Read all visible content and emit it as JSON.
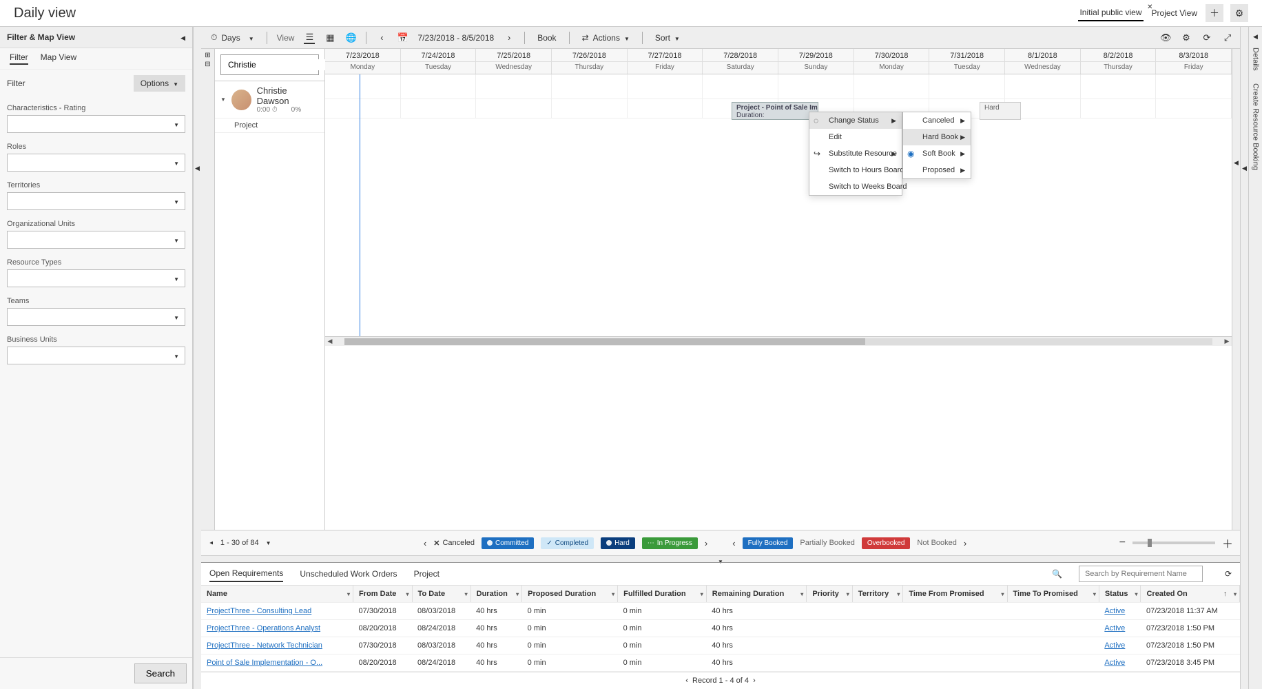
{
  "title": "Daily view",
  "views": {
    "active": "Initial public view",
    "other": "Project View"
  },
  "toolbar": {
    "days": "Days",
    "view": "View",
    "date_range": "7/23/2018 - 8/5/2018",
    "book": "Book",
    "actions": "Actions",
    "sort": "Sort"
  },
  "sidebar": {
    "title": "Filter & Map View",
    "tabs": {
      "filter": "Filter",
      "map": "Map View"
    },
    "filter_label": "Filter",
    "options": "Options",
    "fields": [
      "Characteristics - Rating",
      "Roles",
      "Territories",
      "Organizational Units",
      "Resource Types",
      "Teams",
      "Business Units"
    ],
    "search": "Search"
  },
  "resource": {
    "search_value": "Christie",
    "name": "Christie Dawson",
    "hours": "0:00",
    "pct": "0%",
    "sub": "Project"
  },
  "calendar": {
    "dates": [
      "7/23/2018",
      "7/24/2018",
      "7/25/2018",
      "7/26/2018",
      "7/27/2018",
      "7/28/2018",
      "7/29/2018",
      "7/30/2018",
      "7/31/2018",
      "8/1/2018",
      "8/2/2018",
      "8/3/2018"
    ],
    "dows": [
      "Monday",
      "Tuesday",
      "Wednesday",
      "Thursday",
      "Friday",
      "Saturday",
      "Sunday",
      "Monday",
      "Tuesday",
      "Wednesday",
      "Thursday",
      "Friday"
    ],
    "booking_title": "Project - Point of Sale Implemen",
    "booking_sub": "Duration:",
    "booking2": "Hard"
  },
  "context_menu": {
    "change_status": "Change Status",
    "edit": "Edit",
    "substitute": "Substitute Resource",
    "hours": "Switch to Hours Board",
    "weeks": "Switch to Weeks Board",
    "canceled": "Canceled",
    "hard_book": "Hard Book",
    "soft_book": "Soft Book",
    "proposed": "Proposed"
  },
  "pager": {
    "range": "1 - 30 of 84"
  },
  "legend": {
    "canceled": "Canceled",
    "committed": "Committed",
    "completed": "Completed",
    "hard": "Hard",
    "inprogress": "In Progress",
    "fully": "Fully Booked",
    "partial": "Partially Booked",
    "over": "Overbooked",
    "not": "Not Booked"
  },
  "rails": {
    "details": "Details",
    "create": "Create Resource Booking"
  },
  "bottom": {
    "tabs": {
      "open": "Open Requirements",
      "unsched": "Unscheduled Work Orders",
      "project": "Project"
    },
    "search_placeholder": "Search by Requirement Name",
    "columns": [
      "Name",
      "From Date",
      "To Date",
      "Duration",
      "Proposed Duration",
      "Fulfilled Duration",
      "Remaining Duration",
      "Priority",
      "Territory",
      "Time From Promised",
      "Time To Promised",
      "Status",
      "Created On"
    ],
    "rows": [
      {
        "name": "ProjectThree - Consulting Lead",
        "from": "07/30/2018",
        "to": "08/03/2018",
        "dur": "40 hrs",
        "pd": "0 min",
        "fd": "0 min",
        "rd": "40 hrs",
        "status": "Active",
        "created": "07/23/2018 11:37 AM"
      },
      {
        "name": "ProjectThree - Operations Analyst",
        "from": "08/20/2018",
        "to": "08/24/2018",
        "dur": "40 hrs",
        "pd": "0 min",
        "fd": "0 min",
        "rd": "40 hrs",
        "status": "Active",
        "created": "07/23/2018 1:50 PM"
      },
      {
        "name": "ProjectThree - Network Technician",
        "from": "07/30/2018",
        "to": "08/03/2018",
        "dur": "40 hrs",
        "pd": "0 min",
        "fd": "0 min",
        "rd": "40 hrs",
        "status": "Active",
        "created": "07/23/2018 1:50 PM"
      },
      {
        "name": "Point of Sale Implementation - O...",
        "from": "08/20/2018",
        "to": "08/24/2018",
        "dur": "40 hrs",
        "pd": "0 min",
        "fd": "0 min",
        "rd": "40 hrs",
        "status": "Active",
        "created": "07/23/2018 3:45 PM"
      }
    ],
    "pager": "Record 1 - 4 of 4"
  }
}
